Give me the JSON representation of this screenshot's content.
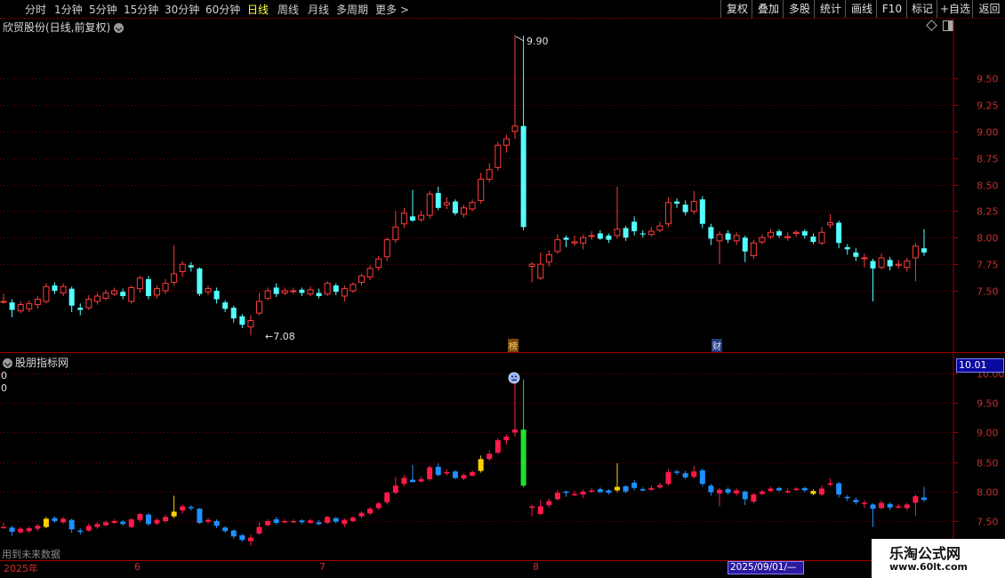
{
  "toolbar": {
    "periods": [
      "分时",
      "1分钟",
      "5分钟",
      "15分钟",
      "30分钟",
      "60分钟",
      "日线",
      "周线",
      "月线",
      "多周期",
      "更多 >"
    ],
    "active_period": "日线",
    "right_buttons": [
      "复权",
      "叠加",
      "多股",
      "统计",
      "画线",
      "F10",
      "标记",
      "+自选",
      "返回"
    ]
  },
  "main_chart": {
    "title": "欣贸股份(日线,前复权)",
    "high_label": "9.90",
    "low_label": "←7.08",
    "y_ticks": [
      "9.50",
      "9.25",
      "9.00",
      "8.75",
      "8.50",
      "8.25",
      "8.00",
      "7.75",
      "7.50"
    ],
    "markers": [
      "榜",
      "财"
    ]
  },
  "indicator_chart": {
    "title": "股朋指标网",
    "label_a": "0",
    "label_b": "0",
    "current_value": "10.01",
    "y_ticks": [
      "10.00",
      "9.50",
      "9.00",
      "8.50",
      "8.00",
      "7.50"
    ]
  },
  "footer": {
    "future_note": "用到未来数据",
    "x_labels": [
      "2025年",
      "6",
      "7",
      "8"
    ],
    "cursor_date": "2025/09/01/—",
    "watermark_title": "乐淘公式网",
    "watermark_url": "www.60lt.com"
  },
  "colors": {
    "up": "#ff3c3c",
    "down": "#54ffff",
    "grid": "#7a0000",
    "indicator_up": "#ff1a4a",
    "indicator_down": "#1e90ff",
    "indicator_limit": "#20e030",
    "indicator_yellow": "#ffd000"
  },
  "chart_data": {
    "type": "candlestick",
    "ylim_main": [
      7.05,
      9.95
    ],
    "ylim_indicator": [
      7.05,
      10.05
    ],
    "candles": [
      [
        7.4,
        7.4,
        7.47,
        7.38
      ],
      [
        7.39,
        7.32,
        7.42,
        7.25
      ],
      [
        7.31,
        7.37,
        7.4,
        7.29
      ],
      [
        7.33,
        7.38,
        7.41,
        7.3
      ],
      [
        7.37,
        7.42,
        7.45,
        7.33
      ],
      [
        7.4,
        7.54,
        7.57,
        7.38
      ],
      [
        7.55,
        7.5,
        7.58,
        7.47
      ],
      [
        7.48,
        7.54,
        7.57,
        7.45
      ],
      [
        7.52,
        7.36,
        7.54,
        7.3
      ],
      [
        7.34,
        7.32,
        7.38,
        7.27
      ],
      [
        7.34,
        7.42,
        7.46,
        7.32
      ],
      [
        7.4,
        7.45,
        7.48,
        7.37
      ],
      [
        7.43,
        7.48,
        7.51,
        7.41
      ],
      [
        7.47,
        7.5,
        7.53,
        7.45
      ],
      [
        7.49,
        7.45,
        7.52,
        7.42
      ],
      [
        7.4,
        7.53,
        7.55,
        7.38
      ],
      [
        7.52,
        7.62,
        7.64,
        7.48
      ],
      [
        7.61,
        7.45,
        7.64,
        7.42
      ],
      [
        7.46,
        7.52,
        7.55,
        7.43
      ],
      [
        7.5,
        7.57,
        7.61,
        7.47
      ],
      [
        7.58,
        7.66,
        7.93,
        7.55
      ],
      [
        7.68,
        7.75,
        7.78,
        7.63
      ],
      [
        7.74,
        7.72,
        7.77,
        7.68
      ],
      [
        7.71,
        7.47,
        7.72,
        7.45
      ],
      [
        7.49,
        7.52,
        7.55,
        7.46
      ],
      [
        7.5,
        7.42,
        7.53,
        7.38
      ],
      [
        7.39,
        7.33,
        7.41,
        7.3
      ],
      [
        7.34,
        7.24,
        7.36,
        7.2
      ],
      [
        7.26,
        7.18,
        7.28,
        7.15
      ],
      [
        7.16,
        7.22,
        7.27,
        7.08
      ],
      [
        7.29,
        7.4,
        7.48,
        7.27
      ],
      [
        7.43,
        7.5,
        7.53,
        7.41
      ],
      [
        7.53,
        7.47,
        7.57,
        7.44
      ],
      [
        7.48,
        7.5,
        7.53,
        7.46
      ],
      [
        7.5,
        7.5,
        7.53,
        7.47
      ],
      [
        7.51,
        7.48,
        7.53,
        7.45
      ],
      [
        7.47,
        7.51,
        7.54,
        7.45
      ],
      [
        7.48,
        7.45,
        7.52,
        7.43
      ],
      [
        7.47,
        7.57,
        7.59,
        7.45
      ],
      [
        7.55,
        7.49,
        7.57,
        7.46
      ],
      [
        7.45,
        7.52,
        7.55,
        7.4
      ],
      [
        7.5,
        7.56,
        7.58,
        7.48
      ],
      [
        7.58,
        7.64,
        7.66,
        7.55
      ],
      [
        7.63,
        7.71,
        7.74,
        7.6
      ],
      [
        7.72,
        7.8,
        7.83,
        7.69
      ],
      [
        7.82,
        7.98,
        8.0,
        7.78
      ],
      [
        7.98,
        8.1,
        8.25,
        7.95
      ],
      [
        8.13,
        8.23,
        8.28,
        8.09
      ],
      [
        8.2,
        8.16,
        8.45,
        8.15
      ],
      [
        8.17,
        8.21,
        8.25,
        8.15
      ],
      [
        8.21,
        8.41,
        8.44,
        8.18
      ],
      [
        8.42,
        8.28,
        8.48,
        8.26
      ],
      [
        8.31,
        8.33,
        8.38,
        8.27
      ],
      [
        8.34,
        8.23,
        8.36,
        8.21
      ],
      [
        8.22,
        8.28,
        8.31,
        8.19
      ],
      [
        8.27,
        8.33,
        8.36,
        8.25
      ],
      [
        8.35,
        8.55,
        8.61,
        8.32
      ],
      [
        8.55,
        8.64,
        8.7,
        8.52
      ],
      [
        8.66,
        8.87,
        8.9,
        8.63
      ],
      [
        8.87,
        8.93,
        8.97,
        8.8
      ],
      [
        9.0,
        9.05,
        9.91,
        8.93
      ],
      [
        9.05,
        8.1,
        9.9,
        8.07
      ],
      [
        7.73,
        7.75,
        7.77,
        7.58
      ],
      [
        7.62,
        7.75,
        7.86,
        7.6
      ],
      [
        7.77,
        7.84,
        7.88,
        7.73
      ],
      [
        7.87,
        7.98,
        8.03,
        7.85
      ],
      [
        8.0,
        7.98,
        8.02,
        7.91
      ],
      [
        7.95,
        7.96,
        8.02,
        7.92
      ],
      [
        7.95,
        8.0,
        8.03,
        7.89
      ],
      [
        8.02,
        8.02,
        8.06,
        7.98
      ],
      [
        8.04,
        7.99,
        8.07,
        7.98
      ],
      [
        8.02,
        7.98,
        8.04,
        7.95
      ],
      [
        8.02,
        8.08,
        8.48,
        7.99
      ],
      [
        8.09,
        8.0,
        8.11,
        7.97
      ],
      [
        8.15,
        8.06,
        8.2,
        8.02
      ],
      [
        8.04,
        8.03,
        8.07,
        8.0
      ],
      [
        8.03,
        8.06,
        8.1,
        8.01
      ],
      [
        8.07,
        8.11,
        8.15,
        8.05
      ],
      [
        8.13,
        8.33,
        8.38,
        8.1
      ],
      [
        8.34,
        8.32,
        8.37,
        8.28
      ],
      [
        8.31,
        8.24,
        8.35,
        8.21
      ],
      [
        8.25,
        8.34,
        8.44,
        8.22
      ],
      [
        8.36,
        8.13,
        8.39,
        8.09
      ],
      [
        8.1,
        7.99,
        8.13,
        7.93
      ],
      [
        7.97,
        8.03,
        8.06,
        7.75
      ],
      [
        8.04,
        7.98,
        8.07,
        7.95
      ],
      [
        7.97,
        8.02,
        8.05,
        7.93
      ],
      [
        8.0,
        7.87,
        8.02,
        7.77
      ],
      [
        7.83,
        7.95,
        7.98,
        7.8
      ],
      [
        7.96,
        8.0,
        8.03,
        7.94
      ],
      [
        8.01,
        8.05,
        8.08,
        7.99
      ],
      [
        8.06,
        8.02,
        8.08,
        8.0
      ],
      [
        8.0,
        8.01,
        8.05,
        7.97
      ],
      [
        8.04,
        8.05,
        8.07,
        8.01
      ],
      [
        8.06,
        8.02,
        8.08,
        7.99
      ],
      [
        8.01,
        7.96,
        8.04,
        7.94
      ],
      [
        7.95,
        8.05,
        8.1,
        7.93
      ],
      [
        8.12,
        8.14,
        8.22,
        8.09
      ],
      [
        8.14,
        7.95,
        8.16,
        7.9
      ],
      [
        7.91,
        7.89,
        7.94,
        7.84
      ],
      [
        7.86,
        7.82,
        7.9,
        7.78
      ],
      [
        7.81,
        7.81,
        7.85,
        7.72
      ],
      [
        7.78,
        7.71,
        7.8,
        7.4
      ],
      [
        7.72,
        7.81,
        7.85,
        7.7
      ],
      [
        7.79,
        7.73,
        7.82,
        7.69
      ],
      [
        7.74,
        7.75,
        7.79,
        7.71
      ],
      [
        7.72,
        7.78,
        7.81,
        7.68
      ],
      [
        7.81,
        7.92,
        7.95,
        7.59
      ],
      [
        7.9,
        7.86,
        8.08,
        7.83
      ]
    ],
    "marker_positions": {
      "榜": 61,
      "财": 84
    },
    "indicator_notes": "Lower panel repeats the price series coloured by indicator state"
  }
}
